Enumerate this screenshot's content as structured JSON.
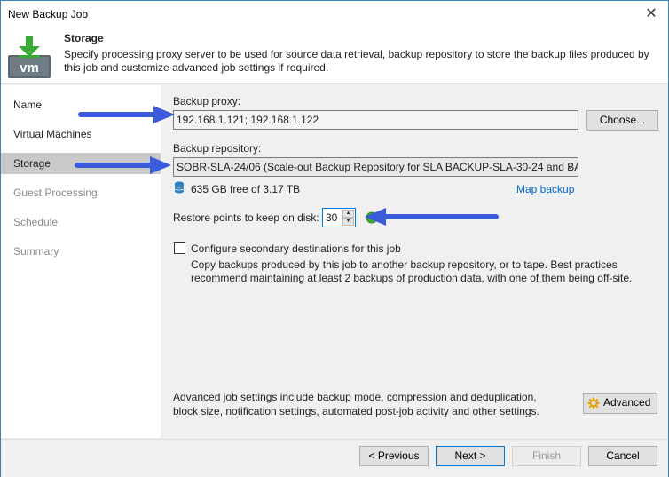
{
  "window": {
    "title": "New Backup Job",
    "close_glyph": "✕"
  },
  "header": {
    "title": "Storage",
    "description": "Specify processing proxy server to be used for source data retrieval, backup repository to store the backup files produced by this job and customize advanced job settings if required.",
    "icon_text": "vm",
    "accent_color": "#3aaa35"
  },
  "nav": {
    "items": [
      {
        "label": "Name",
        "state": "normal"
      },
      {
        "label": "Virtual Machines",
        "state": "normal"
      },
      {
        "label": "Storage",
        "state": "active"
      },
      {
        "label": "Guest Processing",
        "state": "disabled"
      },
      {
        "label": "Schedule",
        "state": "disabled"
      },
      {
        "label": "Summary",
        "state": "disabled"
      }
    ]
  },
  "form": {
    "proxy_label": "Backup proxy:",
    "proxy_value": "192.168.1.121; 192.168.1.122",
    "choose_button": "Choose...",
    "repository_label": "Backup repository:",
    "repository_value": "SOBR-SLA-24/06 (Scale-out Backup Repository for SLA BACKUP-SLA-30-24 and BA",
    "free_space": "635 GB free of 3.17 TB",
    "map_backup": "Map backup",
    "restore_points_label": "Restore points to keep on disk:",
    "restore_points_value": "30",
    "secondary_checkbox_label": "Configure secondary destinations for this job",
    "secondary_checked": false,
    "secondary_desc": "Copy backups produced by this job to another backup repository, or to tape. Best practices recommend maintaining at least 2 backups of production data, with one of them being off-site.",
    "advanced_desc": "Advanced job settings include backup mode, compression and deduplication, block size, notification settings, automated post-job activity and other settings.",
    "advanced_button": "Advanced"
  },
  "footer": {
    "previous": "< Previous",
    "next": "Next >",
    "finish": "Finish",
    "cancel": "Cancel"
  },
  "annotation": {
    "arrow_color": "#3b5bdb"
  }
}
